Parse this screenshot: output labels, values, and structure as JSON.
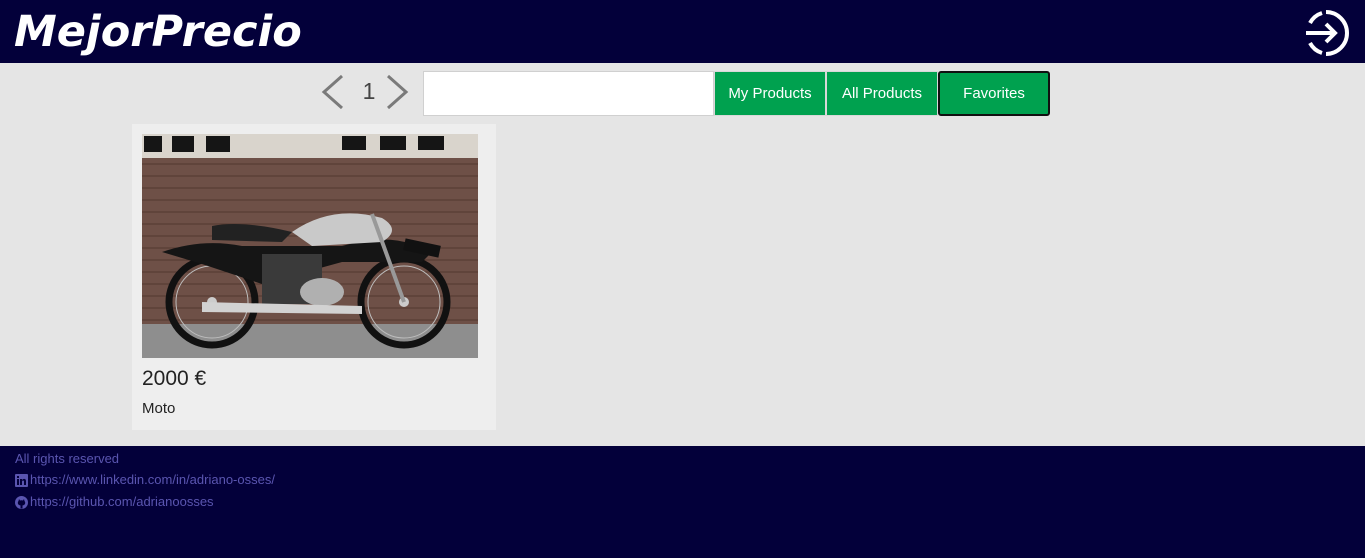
{
  "header": {
    "logo_text": "MejorPrecio",
    "login_icon": "login-icon"
  },
  "pagination": {
    "page": "1",
    "prev_icon": "chevron-left-icon",
    "next_icon": "chevron-right-icon"
  },
  "search": {
    "value": "",
    "placeholder": ""
  },
  "nav": {
    "my_products": "My Products",
    "all_products": "All Products",
    "favorites": "Favorites"
  },
  "colors": {
    "header_bg": "#03003a",
    "button_green": "#00a14f",
    "page_bg": "#e5e5e5"
  },
  "products": [
    {
      "price": "2000 €",
      "name": "Moto",
      "image": "motorcycle-image"
    }
  ],
  "footer": {
    "rights": "All rights reserved",
    "linkedin": "https://www.linkedin.com/in/adriano-osses/",
    "github": "https://github.com/adrianoosses",
    "linkedin_icon": "linkedin-icon",
    "github_icon": "github-icon"
  }
}
